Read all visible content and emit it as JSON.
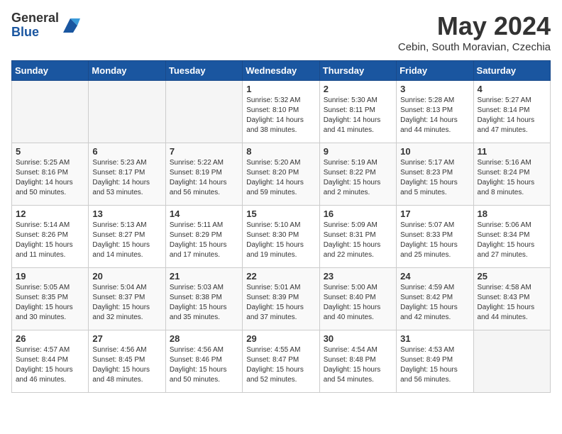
{
  "header": {
    "logo_general": "General",
    "logo_blue": "Blue",
    "month_title": "May 2024",
    "subtitle": "Cebin, South Moravian, Czechia"
  },
  "weekdays": [
    "Sunday",
    "Monday",
    "Tuesday",
    "Wednesday",
    "Thursday",
    "Friday",
    "Saturday"
  ],
  "weeks": [
    [
      {
        "day": "",
        "content": ""
      },
      {
        "day": "",
        "content": ""
      },
      {
        "day": "",
        "content": ""
      },
      {
        "day": "1",
        "content": "Sunrise: 5:32 AM\nSunset: 8:10 PM\nDaylight: 14 hours\nand 38 minutes."
      },
      {
        "day": "2",
        "content": "Sunrise: 5:30 AM\nSunset: 8:11 PM\nDaylight: 14 hours\nand 41 minutes."
      },
      {
        "day": "3",
        "content": "Sunrise: 5:28 AM\nSunset: 8:13 PM\nDaylight: 14 hours\nand 44 minutes."
      },
      {
        "day": "4",
        "content": "Sunrise: 5:27 AM\nSunset: 8:14 PM\nDaylight: 14 hours\nand 47 minutes."
      }
    ],
    [
      {
        "day": "5",
        "content": "Sunrise: 5:25 AM\nSunset: 8:16 PM\nDaylight: 14 hours\nand 50 minutes."
      },
      {
        "day": "6",
        "content": "Sunrise: 5:23 AM\nSunset: 8:17 PM\nDaylight: 14 hours\nand 53 minutes."
      },
      {
        "day": "7",
        "content": "Sunrise: 5:22 AM\nSunset: 8:19 PM\nDaylight: 14 hours\nand 56 minutes."
      },
      {
        "day": "8",
        "content": "Sunrise: 5:20 AM\nSunset: 8:20 PM\nDaylight: 14 hours\nand 59 minutes."
      },
      {
        "day": "9",
        "content": "Sunrise: 5:19 AM\nSunset: 8:22 PM\nDaylight: 15 hours\nand 2 minutes."
      },
      {
        "day": "10",
        "content": "Sunrise: 5:17 AM\nSunset: 8:23 PM\nDaylight: 15 hours\nand 5 minutes."
      },
      {
        "day": "11",
        "content": "Sunrise: 5:16 AM\nSunset: 8:24 PM\nDaylight: 15 hours\nand 8 minutes."
      }
    ],
    [
      {
        "day": "12",
        "content": "Sunrise: 5:14 AM\nSunset: 8:26 PM\nDaylight: 15 hours\nand 11 minutes."
      },
      {
        "day": "13",
        "content": "Sunrise: 5:13 AM\nSunset: 8:27 PM\nDaylight: 15 hours\nand 14 minutes."
      },
      {
        "day": "14",
        "content": "Sunrise: 5:11 AM\nSunset: 8:29 PM\nDaylight: 15 hours\nand 17 minutes."
      },
      {
        "day": "15",
        "content": "Sunrise: 5:10 AM\nSunset: 8:30 PM\nDaylight: 15 hours\nand 19 minutes."
      },
      {
        "day": "16",
        "content": "Sunrise: 5:09 AM\nSunset: 8:31 PM\nDaylight: 15 hours\nand 22 minutes."
      },
      {
        "day": "17",
        "content": "Sunrise: 5:07 AM\nSunset: 8:33 PM\nDaylight: 15 hours\nand 25 minutes."
      },
      {
        "day": "18",
        "content": "Sunrise: 5:06 AM\nSunset: 8:34 PM\nDaylight: 15 hours\nand 27 minutes."
      }
    ],
    [
      {
        "day": "19",
        "content": "Sunrise: 5:05 AM\nSunset: 8:35 PM\nDaylight: 15 hours\nand 30 minutes."
      },
      {
        "day": "20",
        "content": "Sunrise: 5:04 AM\nSunset: 8:37 PM\nDaylight: 15 hours\nand 32 minutes."
      },
      {
        "day": "21",
        "content": "Sunrise: 5:03 AM\nSunset: 8:38 PM\nDaylight: 15 hours\nand 35 minutes."
      },
      {
        "day": "22",
        "content": "Sunrise: 5:01 AM\nSunset: 8:39 PM\nDaylight: 15 hours\nand 37 minutes."
      },
      {
        "day": "23",
        "content": "Sunrise: 5:00 AM\nSunset: 8:40 PM\nDaylight: 15 hours\nand 40 minutes."
      },
      {
        "day": "24",
        "content": "Sunrise: 4:59 AM\nSunset: 8:42 PM\nDaylight: 15 hours\nand 42 minutes."
      },
      {
        "day": "25",
        "content": "Sunrise: 4:58 AM\nSunset: 8:43 PM\nDaylight: 15 hours\nand 44 minutes."
      }
    ],
    [
      {
        "day": "26",
        "content": "Sunrise: 4:57 AM\nSunset: 8:44 PM\nDaylight: 15 hours\nand 46 minutes."
      },
      {
        "day": "27",
        "content": "Sunrise: 4:56 AM\nSunset: 8:45 PM\nDaylight: 15 hours\nand 48 minutes."
      },
      {
        "day": "28",
        "content": "Sunrise: 4:56 AM\nSunset: 8:46 PM\nDaylight: 15 hours\nand 50 minutes."
      },
      {
        "day": "29",
        "content": "Sunrise: 4:55 AM\nSunset: 8:47 PM\nDaylight: 15 hours\nand 52 minutes."
      },
      {
        "day": "30",
        "content": "Sunrise: 4:54 AM\nSunset: 8:48 PM\nDaylight: 15 hours\nand 54 minutes."
      },
      {
        "day": "31",
        "content": "Sunrise: 4:53 AM\nSunset: 8:49 PM\nDaylight: 15 hours\nand 56 minutes."
      },
      {
        "day": "",
        "content": ""
      }
    ]
  ]
}
